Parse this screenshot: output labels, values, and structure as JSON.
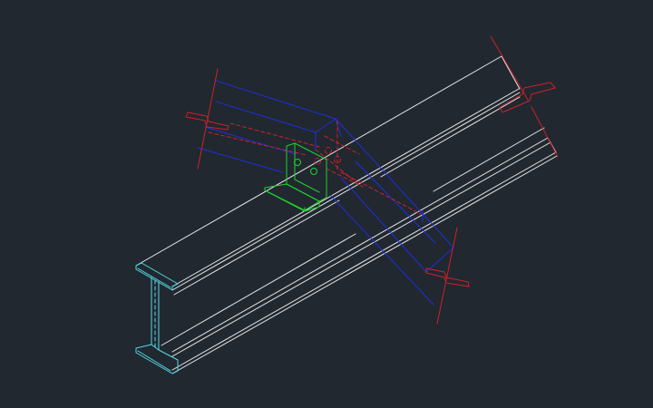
{
  "scene": {
    "description_type": "cad-isometric-view",
    "background": "#212830",
    "colors": {
      "main_beam": "#e6e6e6",
      "section_face": "#52dbe6",
      "secondary_beam": "#1f2fdd",
      "cut_symbols": "#d11f2a",
      "hidden_lines": "#d11f2a",
      "angle_cleat": "#1fd12f"
    }
  }
}
